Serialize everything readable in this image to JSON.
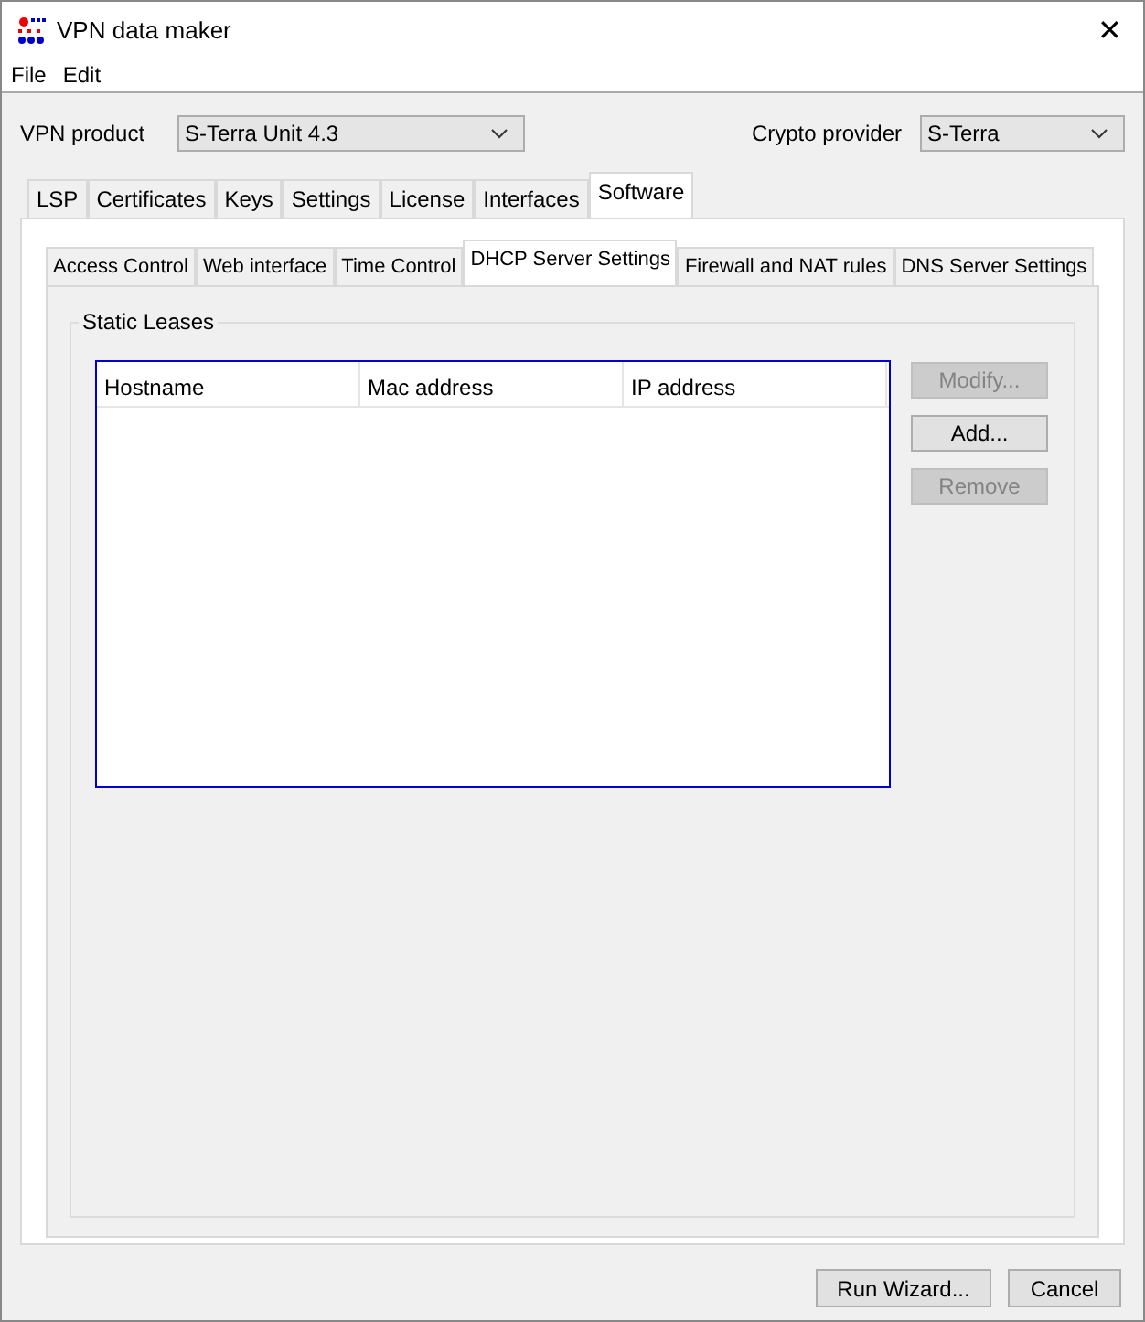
{
  "window": {
    "title": "VPN data maker",
    "close": "✕"
  },
  "menu": [
    "File",
    "Edit"
  ],
  "vpn_product": {
    "label": "VPN product",
    "value": "S-Terra Unit 4.3"
  },
  "crypto_provider": {
    "label": "Crypto provider",
    "value": "S-Terra"
  },
  "tabs": [
    {
      "label": "LSP",
      "selected": false
    },
    {
      "label": "Certificates",
      "selected": false
    },
    {
      "label": "Keys",
      "selected": false
    },
    {
      "label": "Settings",
      "selected": false
    },
    {
      "label": "License",
      "selected": false
    },
    {
      "label": "Interfaces",
      "selected": false
    },
    {
      "label": "Software",
      "selected": true
    }
  ],
  "subtabs": [
    {
      "label": "Access Control",
      "selected": false
    },
    {
      "label": "Web interface",
      "selected": false
    },
    {
      "label": "Time Control",
      "selected": false
    },
    {
      "label": "DHCP Server Settings",
      "selected": true
    },
    {
      "label": "Firewall and NAT rules",
      "selected": false
    },
    {
      "label": "DNS Server Settings",
      "selected": false
    }
  ],
  "static_leases": {
    "title": "Static Leases",
    "table": {
      "columns": [
        "Hostname",
        "Mac address",
        "IP address"
      ]
    },
    "buttons": [
      {
        "label": "Modify...",
        "disabled": true
      },
      {
        "label": "Add...",
        "disabled": false
      },
      {
        "label": "Remove",
        "disabled": true
      }
    ]
  },
  "footer_buttons": [
    "Run Wizard...",
    "Cancel"
  ]
}
